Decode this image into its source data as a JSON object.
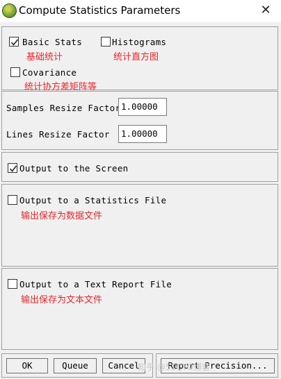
{
  "window": {
    "title": "Compute Statistics Parameters",
    "close_glyph": "✕",
    "app_icon": "envi-globe-icon"
  },
  "stats_panel": {
    "basic_stats": {
      "label": "Basic Stats",
      "checked": true,
      "note": "基础统计"
    },
    "histograms": {
      "label": "Histograms",
      "checked": false,
      "note": "统计直方图"
    },
    "covariance": {
      "label": "Covariance",
      "checked": false,
      "note": "统计协方差矩阵等"
    }
  },
  "resize_panel": {
    "samples": {
      "label": "Samples Resize Factor",
      "value": "1.00000"
    },
    "lines": {
      "label": "Lines Resize Factor",
      "value": "1.00000"
    }
  },
  "screen_panel": {
    "label": "Output to the Screen",
    "checked": true
  },
  "stats_file_panel": {
    "label": "Output to a Statistics File",
    "checked": false,
    "note": "输出保存为数据文件"
  },
  "report_file_panel": {
    "label": "Output to a Text Report File",
    "checked": false,
    "note": "输出保存为文本文件"
  },
  "buttons": {
    "ok": "OK",
    "queue": "Queue",
    "cancel": "Cancel",
    "report_precision": "Report Precision..."
  },
  "watermark": "知乎 @51CTO博客"
}
